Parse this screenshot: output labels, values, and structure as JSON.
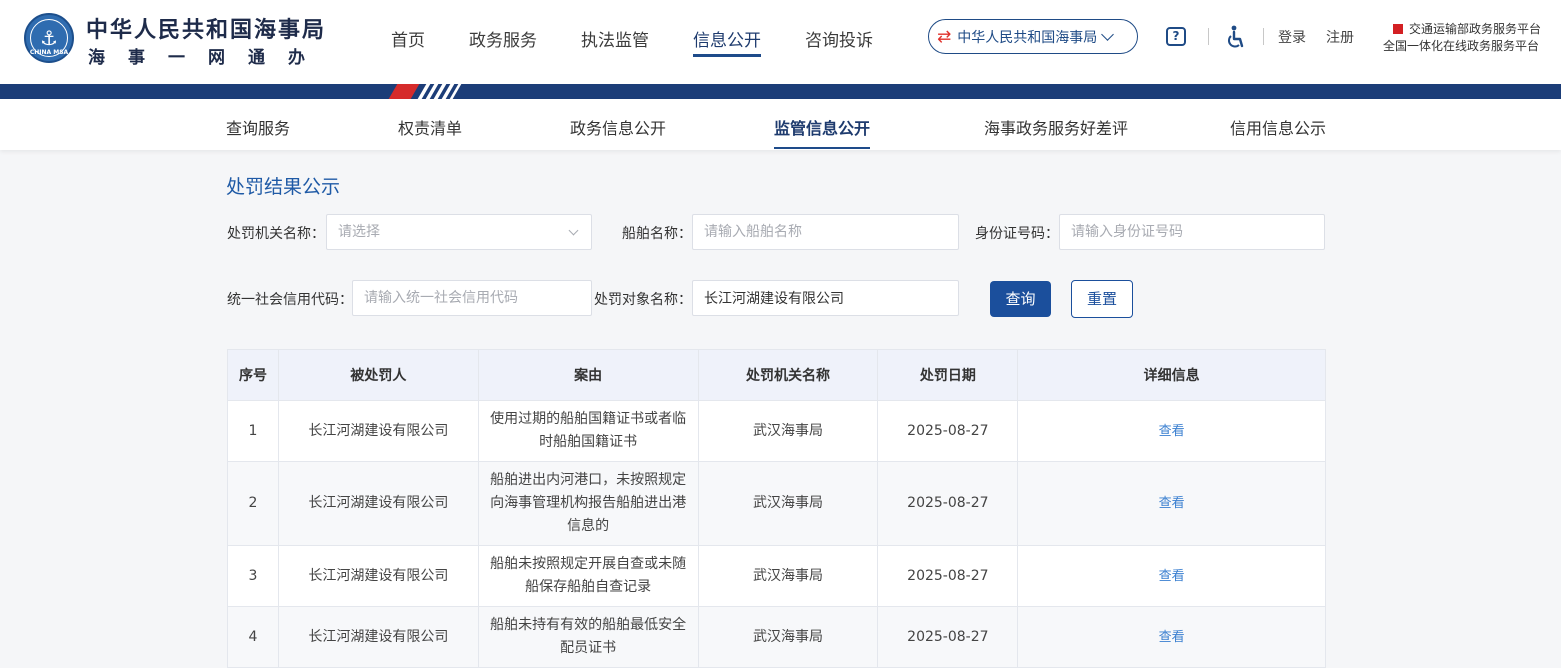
{
  "header": {
    "brand_title": "中华人民共和国海事局",
    "brand_slogan": "海事一网通办",
    "emblem_text": "CHINA MSA",
    "nav": [
      {
        "label": "首页",
        "active": false
      },
      {
        "label": "政务服务",
        "active": false
      },
      {
        "label": "执法监管",
        "active": false
      },
      {
        "label": "信息公开",
        "active": true
      },
      {
        "label": "咨询投诉",
        "active": false
      }
    ],
    "org_selector": "中华人民共和国海事局",
    "login": "登录",
    "register": "注册",
    "platform_1": "交通运输部政务服务平台",
    "platform_2": "全国一体化在线政务服务平台"
  },
  "subnav": [
    {
      "label": "查询服务",
      "active": false
    },
    {
      "label": "权责清单",
      "active": false
    },
    {
      "label": "政务信息公开",
      "active": false
    },
    {
      "label": "监管信息公开",
      "active": true
    },
    {
      "label": "海事政务服务好差评",
      "active": false
    },
    {
      "label": "信用信息公示",
      "active": false
    }
  ],
  "page_title": "处罚结果公示",
  "filters": {
    "authority_label": "处罚机关名称：",
    "authority_placeholder": "请选择",
    "ship_label": "船舶名称：",
    "ship_placeholder": "请输入船舶名称",
    "id_label": "身份证号码：",
    "id_placeholder": "请输入身份证号码",
    "credit_label": "统一社会信用代码：",
    "credit_placeholder": "请输入统一社会信用代码",
    "target_label": "处罚对象名称：",
    "target_value": "长江河湖建设有限公司",
    "query_button": "查询",
    "reset_button": "重置"
  },
  "table": {
    "headers": [
      "序号",
      "被处罚人",
      "案由",
      "处罚机关名称",
      "处罚日期",
      "详细信息"
    ],
    "rows": [
      {
        "no": "1",
        "party": "长江河湖建设有限公司",
        "reason": "使用过期的船舶国籍证书或者临时船舶国籍证书",
        "authority": "武汉海事局",
        "date": "2025-08-27",
        "detail": "查看"
      },
      {
        "no": "2",
        "party": "长江河湖建设有限公司",
        "reason": "船舶进出内河港口，未按照规定向海事管理机构报告船舶进出港信息的",
        "authority": "武汉海事局",
        "date": "2025-08-27",
        "detail": "查看"
      },
      {
        "no": "3",
        "party": "长江河湖建设有限公司",
        "reason": "船舶未按照规定开展自查或未随船保存船舶自查记录",
        "authority": "武汉海事局",
        "date": "2025-08-27",
        "detail": "查看"
      },
      {
        "no": "4",
        "party": "长江河湖建设有限公司",
        "reason": "船舶未持有有效的船舶最低安全配员证书",
        "authority": "武汉海事局",
        "date": "2025-08-27",
        "detail": "查看"
      }
    ]
  }
}
